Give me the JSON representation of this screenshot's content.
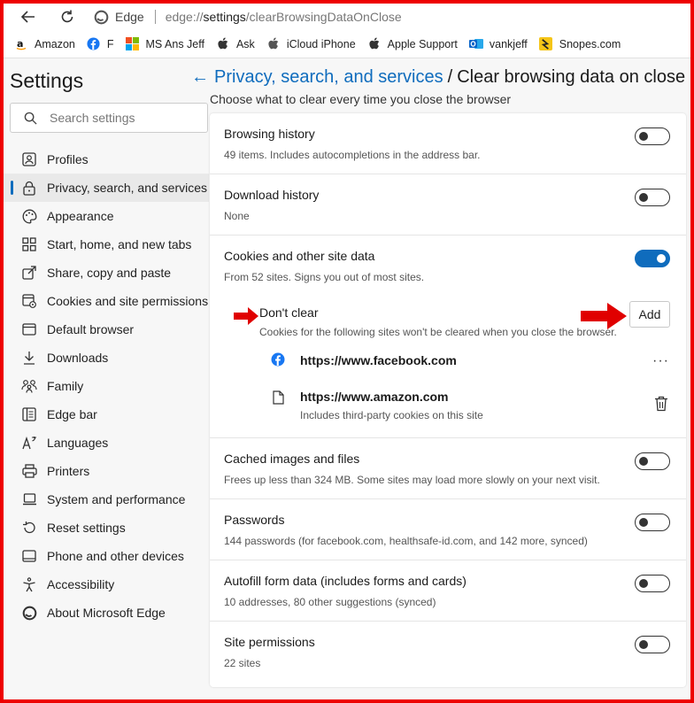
{
  "browser": {
    "edge_label": "Edge",
    "url_prefix": "edge://",
    "url_bold": "settings",
    "url_rest": "/clearBrowsingDataOnClose"
  },
  "favorites": [
    {
      "label": "Amazon",
      "icon": "amazon-icon"
    },
    {
      "label": "F",
      "icon": "facebook-icon"
    },
    {
      "label": "MS Ans Jeff",
      "icon": "microsoft-icon"
    },
    {
      "label": "Ask",
      "icon": "apple-icon"
    },
    {
      "label": "iCloud iPhone",
      "icon": "apple-icon"
    },
    {
      "label": "Apple Support",
      "icon": "apple-icon"
    },
    {
      "label": "vankjeff",
      "icon": "outlook-icon"
    },
    {
      "label": "Snopes.com",
      "icon": "snopes-icon"
    }
  ],
  "sidebar": {
    "title": "Settings",
    "search_placeholder": "Search settings",
    "items": [
      {
        "label": "Profiles",
        "icon": "profile-icon"
      },
      {
        "label": "Privacy, search, and services",
        "icon": "lock-icon"
      },
      {
        "label": "Appearance",
        "icon": "palette-icon"
      },
      {
        "label": "Start, home, and new tabs",
        "icon": "home-grid-icon"
      },
      {
        "label": "Share, copy and paste",
        "icon": "share-icon"
      },
      {
        "label": "Cookies and site permissions",
        "icon": "cookies-icon"
      },
      {
        "label": "Default browser",
        "icon": "browser-icon"
      },
      {
        "label": "Downloads",
        "icon": "download-icon"
      },
      {
        "label": "Family",
        "icon": "family-icon"
      },
      {
        "label": "Edge bar",
        "icon": "edge-bar-icon"
      },
      {
        "label": "Languages",
        "icon": "languages-icon"
      },
      {
        "label": "Printers",
        "icon": "printer-icon"
      },
      {
        "label": "System and performance",
        "icon": "laptop-icon"
      },
      {
        "label": "Reset settings",
        "icon": "reset-icon"
      },
      {
        "label": "Phone and other devices",
        "icon": "phone-icon"
      },
      {
        "label": "Accessibility",
        "icon": "accessibility-icon"
      },
      {
        "label": "About Microsoft Edge",
        "icon": "edge-logo-icon"
      }
    ]
  },
  "main": {
    "breadcrumb_parent": "Privacy, search, and services",
    "breadcrumb_sep": "/",
    "breadcrumb_current": "Clear browsing data on close",
    "description": "Choose what to clear every time you close the browser",
    "rows": [
      {
        "title": "Browsing history",
        "sub": "49 items. Includes autocompletions in the address bar.",
        "toggle": "off"
      },
      {
        "title": "Download history",
        "sub": "None",
        "toggle": "off"
      },
      {
        "title": "Cookies and other site data",
        "sub": "From 52 sites. Signs you out of most sites.",
        "toggle": "on"
      },
      {
        "title": "Cached images and files",
        "sub": "Frees up less than 324 MB. Some sites may load more slowly on your next visit.",
        "toggle": "off"
      },
      {
        "title": "Passwords",
        "sub": "144 passwords (for facebook.com, healthsafe-id.com, and 142 more, synced)",
        "toggle": "off"
      },
      {
        "title": "Autofill form data (includes forms and cards)",
        "sub": "10 addresses, 80 other suggestions (synced)",
        "toggle": "off"
      },
      {
        "title": "Site permissions",
        "sub": "22 sites",
        "toggle": "off"
      }
    ],
    "dont_clear": {
      "title": "Don't clear",
      "description": "Cookies for the following sites won't be cleared when you close the browser.",
      "add_label": "Add",
      "more_label": "···",
      "sites": [
        {
          "url": "https://www.facebook.com",
          "sub": ""
        },
        {
          "url": "https://www.amazon.com",
          "sub": "Includes third-party cookies on this site"
        }
      ]
    }
  },
  "colors": {
    "accent": "#0f6cbd",
    "annotation": "#e00000",
    "frame": "#ee0000"
  }
}
